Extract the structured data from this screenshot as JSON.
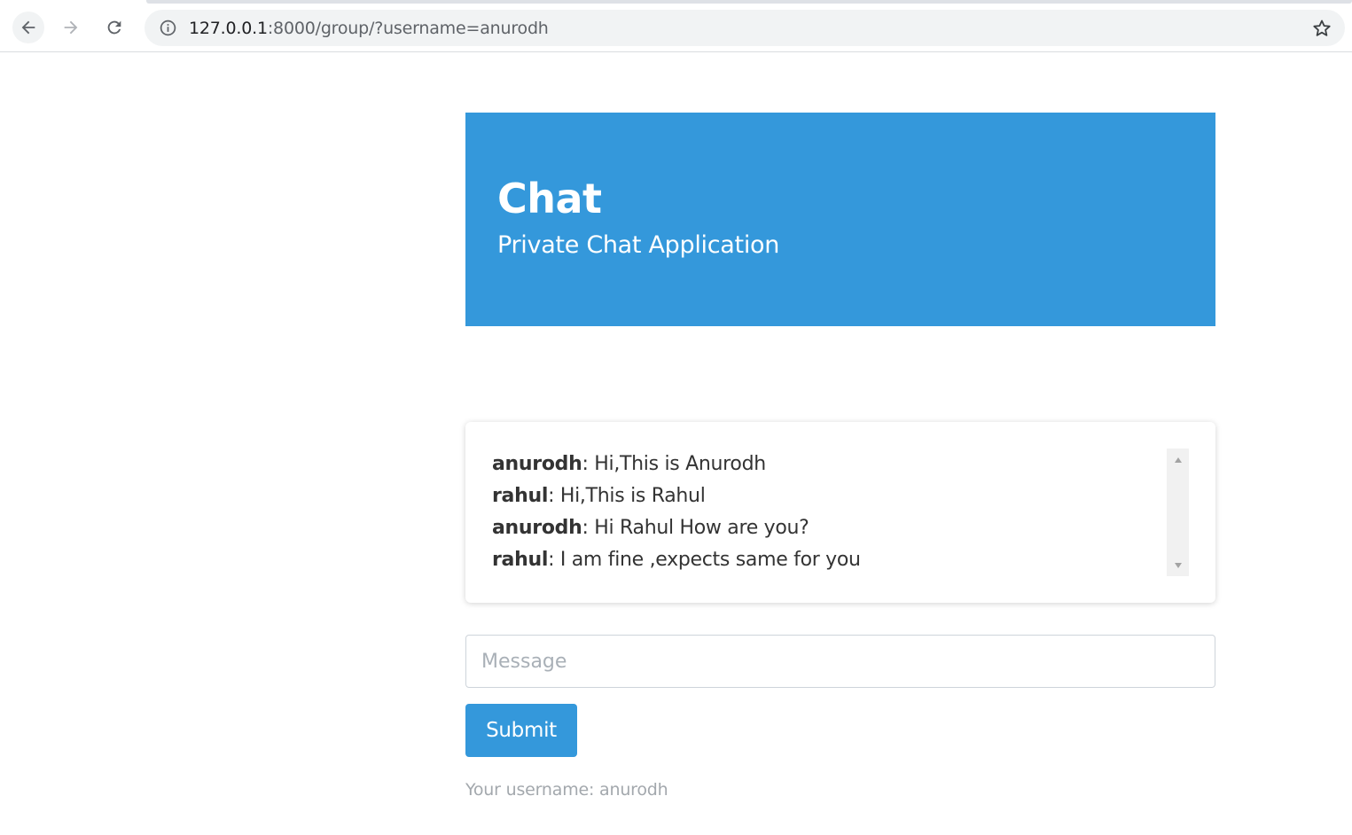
{
  "browser": {
    "url_host": "127.0.0.1",
    "url_rest": ":8000/group/?username=anurodh",
    "icons": {
      "back": "arrow-left-icon",
      "forward": "arrow-right-icon",
      "reload": "reload-icon",
      "info": "info-icon",
      "bookmark": "star-icon"
    }
  },
  "header": {
    "title": "Chat",
    "subtitle": "Private Chat Application",
    "background_color": "#3498db"
  },
  "chat": {
    "messages": [
      {
        "user": "anurodh",
        "text": ": Hi,This is Anurodh"
      },
      {
        "user": "rahul",
        "text": ": Hi,This is Rahul"
      },
      {
        "user": "anurodh",
        "text": ": Hi Rahul How are you?"
      },
      {
        "user": "rahul",
        "text": ": I am fine ,expects same for you"
      }
    ]
  },
  "form": {
    "message_placeholder": "Message",
    "message_value": "",
    "submit_label": "Submit",
    "button_color": "#3498db"
  },
  "footer": {
    "username_note": "Your username: anurodh"
  }
}
